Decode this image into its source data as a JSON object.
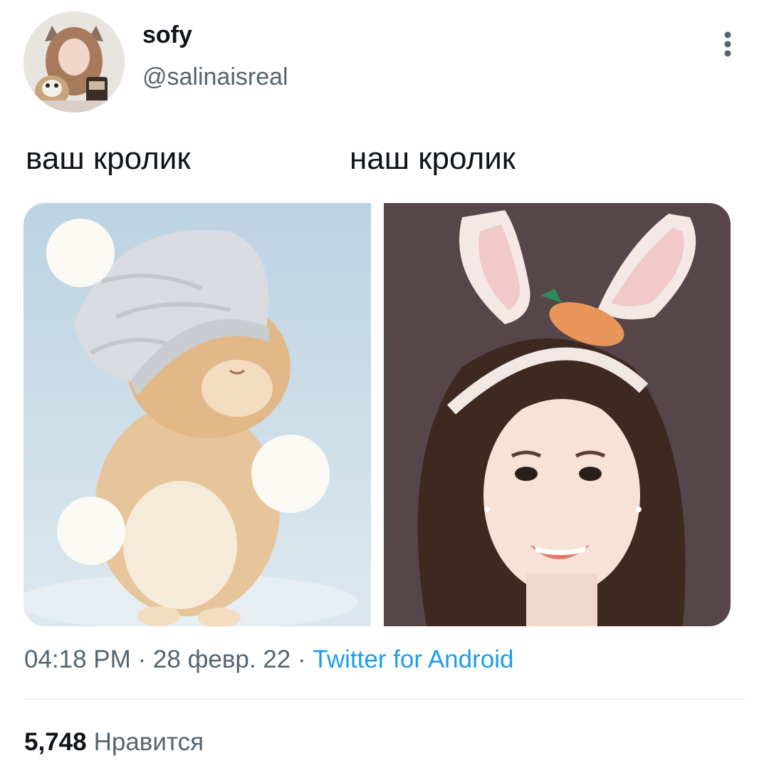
{
  "tweet": {
    "author": {
      "display_name": "sofy",
      "handle": "@salinaisreal",
      "avatar_icon": "profile-photo"
    },
    "more_icon": "vertical-ellipsis-icon",
    "text_left": "ваш кролик",
    "text_right": "наш кролик",
    "media": [
      {
        "icon": "bunny-in-knit-hat-photo"
      },
      {
        "icon": "woman-with-bunny-ears-headband-photo"
      }
    ],
    "meta": {
      "time": "04:18 PM",
      "sep1": " · ",
      "date": "28 февр. 22",
      "sep2": " · ",
      "source": "Twitter for Android"
    },
    "stats": {
      "likes_count": "5,748",
      "likes_label": "Нравится"
    },
    "colors": {
      "text_primary": "#0f1419",
      "text_secondary": "#536471",
      "link": "#1d9bf0",
      "divider": "#eff3f4"
    }
  }
}
